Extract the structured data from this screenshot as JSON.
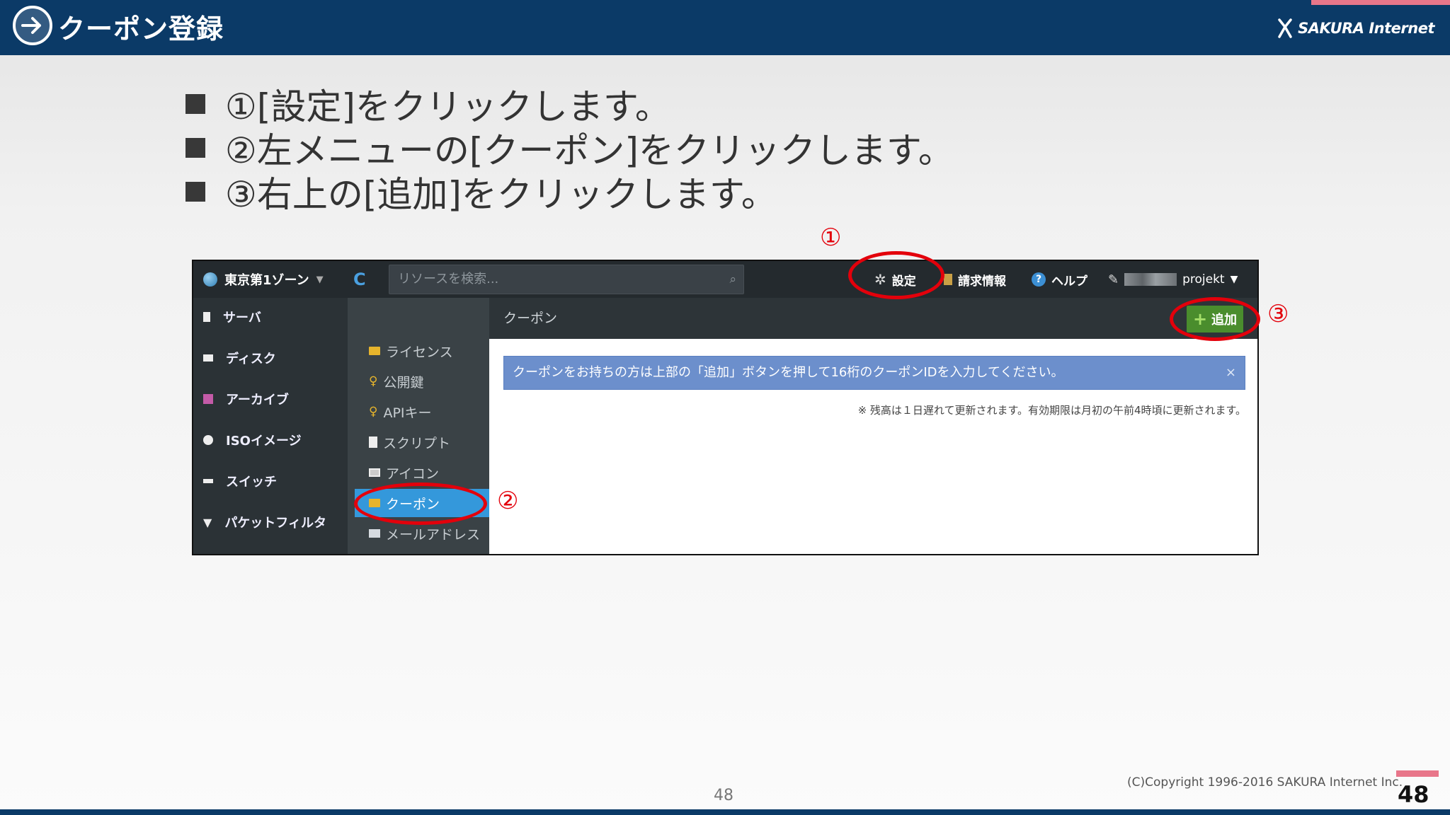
{
  "header": {
    "title": "クーポン登録",
    "logo_text": "SAKURA Internet"
  },
  "bullets": [
    "①[設定]をクリックします。",
    "②左メニューの[クーポン]をクリックします。",
    "③右上の[追加]をクリックします。"
  ],
  "screenshot": {
    "zone_label": "東京第1ゾーン",
    "search_placeholder": "リソースを検索...",
    "topnav": {
      "settings": "設定",
      "billing": "請求情報",
      "help": "ヘルプ",
      "user": "projekt"
    },
    "left_menu": [
      "サーバ",
      "ディスク",
      "アーカイブ",
      "ISOイメージ",
      "スイッチ",
      "パケットフィルタ"
    ],
    "sub_menu": [
      "ライセンス",
      "公開鍵",
      "APIキー",
      "スクリプト",
      "アイコン",
      "クーポン",
      "メールアドレス"
    ],
    "content_title": "クーポン",
    "add_button": "追加",
    "info_message": "クーポンをお持ちの方は上部の「追加」ボタンを押して16桁のクーポンIDを入力してください。",
    "info_close": "×",
    "note": "※ 残高は１日遅れて更新されます。有効期限は月初の午前4時頃に更新されます。"
  },
  "annotations": {
    "one": "①",
    "two": "②",
    "three": "③"
  },
  "footer": {
    "page_center": "48",
    "copyright": "(C)Copyright 1996-2016 SAKURA Internet Inc.",
    "page_right": "48"
  },
  "colors": {
    "header_bg": "#0b3a67",
    "annotation_red": "#e3000b",
    "active_item": "#3498db",
    "add_button": "#4a8d2d",
    "info_bar": "#6c8fcc",
    "logo_accent": "#e8768a"
  }
}
